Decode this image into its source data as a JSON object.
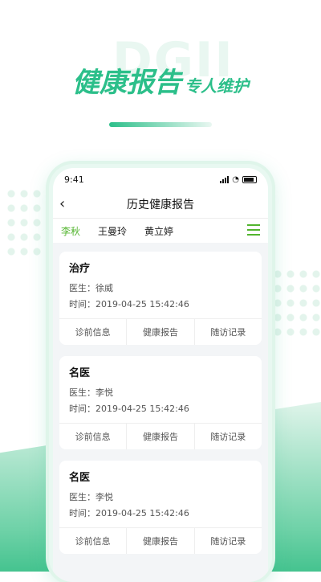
{
  "hero": {
    "title": "健康报告",
    "subtitle": "专人维护"
  },
  "watermark": "DGII",
  "status": {
    "time": "9:41"
  },
  "nav": {
    "title": "历史健康报告"
  },
  "tabs": [
    "李秋",
    "王曼玲",
    "黄立婷"
  ],
  "cards": [
    {
      "title": "治疗",
      "doctor": "医生：徐威",
      "time": "时间：2019-04-25 15:42:46",
      "actions": [
        "诊前信息",
        "健康报告",
        "随访记录"
      ]
    },
    {
      "title": "名医",
      "doctor": "医生：李悦",
      "time": "时间：2019-04-25 15:42:46",
      "actions": [
        "诊前信息",
        "健康报告",
        "随访记录"
      ]
    },
    {
      "title": "名医",
      "doctor": "医生：李悦",
      "time": "时间：2019-04-25 15:42:46",
      "actions": [
        "诊前信息",
        "健康报告",
        "随访记录"
      ]
    }
  ],
  "colors": {
    "brand": "#2cbf8a",
    "tab_active": "#53b52f"
  }
}
